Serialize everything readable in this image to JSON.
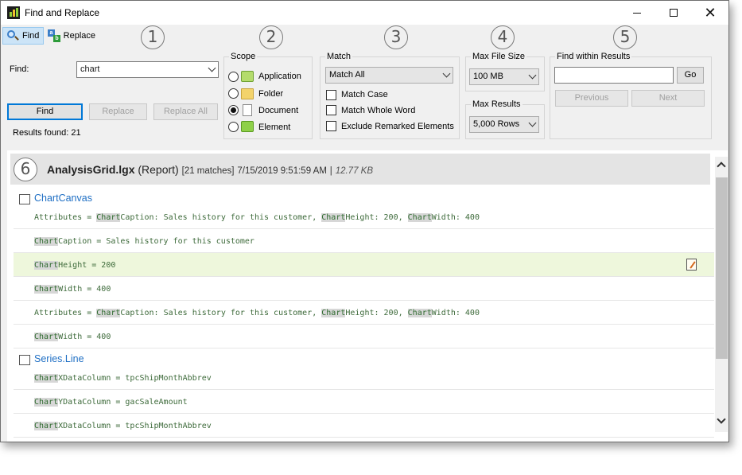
{
  "window": {
    "title": "Find and Replace"
  },
  "tabs": [
    {
      "label": "Find"
    },
    {
      "label": "Replace"
    }
  ],
  "callouts": [
    "1",
    "2",
    "3",
    "4",
    "5",
    "6"
  ],
  "find": {
    "label": "Find:",
    "value": "chart",
    "find_button": "Find",
    "replace_button": "Replace",
    "replace_all_button": "Replace All",
    "results_found": "Results found: 21"
  },
  "scope": {
    "title": "Scope",
    "options": [
      {
        "label": "Application",
        "icon": "application-icon",
        "selected": false
      },
      {
        "label": "Folder",
        "icon": "folder-icon",
        "selected": false
      },
      {
        "label": "Document",
        "icon": "document-icon",
        "selected": true
      },
      {
        "label": "Element",
        "icon": "element-icon",
        "selected": false
      }
    ]
  },
  "match": {
    "title": "Match",
    "selected": "Match All",
    "checkboxes": [
      {
        "label": "Match Case",
        "checked": false
      },
      {
        "label": "Match Whole Word",
        "checked": false
      },
      {
        "label": "Exclude Remarked Elements",
        "checked": false
      }
    ]
  },
  "max_file_size": {
    "title": "Max File Size",
    "selected": "100 MB"
  },
  "max_results": {
    "title": "Max Results",
    "selected": "5,000 Rows"
  },
  "find_within": {
    "title": "Find within Results",
    "value": "",
    "go_button": "Go",
    "previous_button": "Previous",
    "next_button": "Next"
  },
  "results": {
    "file_name": "AnalysisGrid.lgx",
    "file_type": "(Report)",
    "matches": "[21 matches]",
    "date": "7/15/2019 9:51:59 AM",
    "separator": "|",
    "size": "12.77 KB",
    "rows": [
      {
        "kind": "element",
        "icon": "grid-icon",
        "text": "ChartCanvas"
      },
      {
        "kind": "attr",
        "segments": [
          [
            "Attributes = ",
            false
          ],
          [
            "Chart",
            true
          ],
          [
            "Caption: Sales history for this customer, ",
            false
          ],
          [
            "Chart",
            true
          ],
          [
            "Height: 200, ",
            false
          ],
          [
            "Chart",
            true
          ],
          [
            "Width: 400",
            false
          ]
        ]
      },
      {
        "kind": "attr",
        "segments": [
          [
            "Chart",
            true
          ],
          [
            "Caption = Sales history for this customer",
            false
          ]
        ]
      },
      {
        "kind": "attr",
        "highlight": true,
        "edit_icon": true,
        "segments": [
          [
            "Chart",
            true
          ],
          [
            "Height = 200",
            false
          ]
        ]
      },
      {
        "kind": "attr",
        "segments": [
          [
            "Chart",
            true
          ],
          [
            "Width = 400",
            false
          ]
        ]
      },
      {
        "kind": "attr",
        "segments": [
          [
            "Attributes = ",
            false
          ],
          [
            "Chart",
            true
          ],
          [
            "Caption: Sales history for this customer, ",
            false
          ],
          [
            "Chart",
            true
          ],
          [
            "Height: 200, ",
            false
          ],
          [
            "Chart",
            true
          ],
          [
            "Width: 400",
            false
          ]
        ]
      },
      {
        "kind": "attr",
        "segments": [
          [
            "Chart",
            true
          ],
          [
            "Width = 400",
            false
          ]
        ]
      },
      {
        "kind": "element",
        "icon": "line-chart-icon",
        "text": "Series.Line"
      },
      {
        "kind": "attr",
        "segments": [
          [
            "Chart",
            true
          ],
          [
            "XDataColumn = tpcShipMonthAbbrev",
            false
          ]
        ]
      },
      {
        "kind": "attr",
        "segments": [
          [
            "Chart",
            true
          ],
          [
            "YDataColumn = gacSaleAmount",
            false
          ]
        ]
      },
      {
        "kind": "attr",
        "segments": [
          [
            "Chart",
            true
          ],
          [
            "XDataColumn = tpcShipMonthAbbrev",
            false
          ]
        ]
      }
    ]
  }
}
